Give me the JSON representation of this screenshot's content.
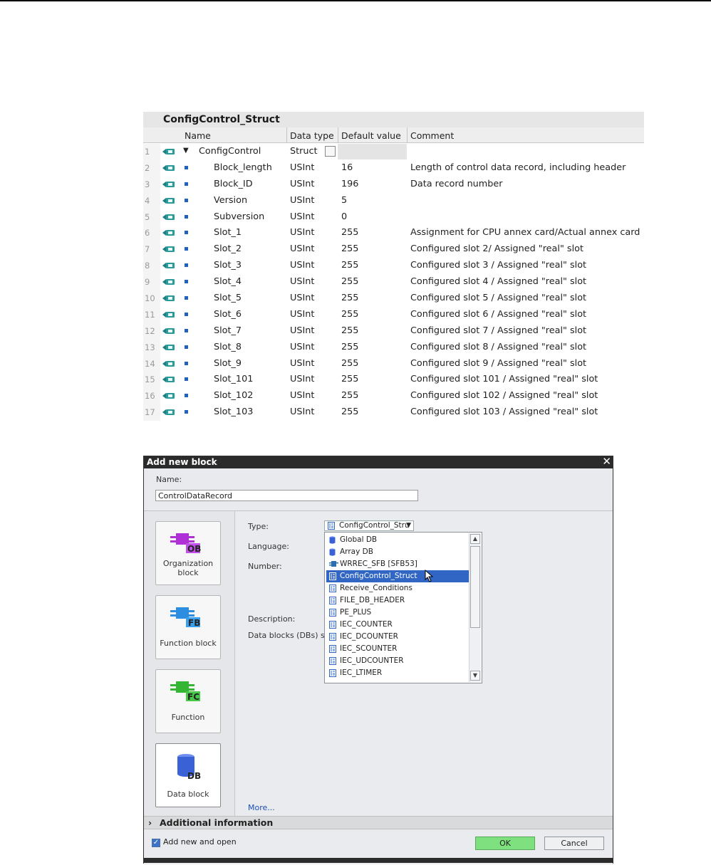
{
  "struct_table": {
    "title": "ConfigControl_Struct",
    "columns": [
      "Name",
      "Data type",
      "Default value",
      "Comment"
    ],
    "rows": [
      {
        "num": "1",
        "name": "ConfigControl",
        "type": "Struct",
        "default": "",
        "comment": ""
      },
      {
        "num": "2",
        "name": "Block_length",
        "type": "USInt",
        "default": "16",
        "comment": "Length of control data record, including header"
      },
      {
        "num": "3",
        "name": "Block_ID",
        "type": "USInt",
        "default": "196",
        "comment": "Data record number"
      },
      {
        "num": "4",
        "name": "Version",
        "type": "USInt",
        "default": "5",
        "comment": ""
      },
      {
        "num": "5",
        "name": "Subversion",
        "type": "USInt",
        "default": "0",
        "comment": ""
      },
      {
        "num": "6",
        "name": "Slot_1",
        "type": "USInt",
        "default": "255",
        "comment": "Assignment for CPU annex card/Actual annex card"
      },
      {
        "num": "7",
        "name": "Slot_2",
        "type": "USInt",
        "default": "255",
        "comment": "Configured slot 2/ Assigned \"real\" slot"
      },
      {
        "num": "8",
        "name": "Slot_3",
        "type": "USInt",
        "default": "255",
        "comment": "Configured slot 3 / Assigned \"real\" slot"
      },
      {
        "num": "9",
        "name": "Slot_4",
        "type": "USInt",
        "default": "255",
        "comment": "Configured slot 4 / Assigned \"real\" slot"
      },
      {
        "num": "10",
        "name": "Slot_5",
        "type": "USInt",
        "default": "255",
        "comment": "Configured slot 5 / Assigned \"real\" slot"
      },
      {
        "num": "11",
        "name": "Slot_6",
        "type": "USInt",
        "default": "255",
        "comment": "Configured slot 6 / Assigned \"real\" slot"
      },
      {
        "num": "12",
        "name": "Slot_7",
        "type": "USInt",
        "default": "255",
        "comment": "Configured slot 7 / Assigned \"real\" slot"
      },
      {
        "num": "13",
        "name": "Slot_8",
        "type": "USInt",
        "default": "255",
        "comment": "Configured slot 8 / Assigned \"real\" slot"
      },
      {
        "num": "14",
        "name": "Slot_9",
        "type": "USInt",
        "default": "255",
        "comment": "Configured slot 9 / Assigned \"real\" slot"
      },
      {
        "num": "15",
        "name": "Slot_101",
        "type": "USInt",
        "default": "255",
        "comment": "Configured slot 101 / Assigned \"real\" slot"
      },
      {
        "num": "16",
        "name": "Slot_102",
        "type": "USInt",
        "default": "255",
        "comment": "Configured slot 102 / Assigned \"real\" slot"
      },
      {
        "num": "17",
        "name": "Slot_103",
        "type": "USInt",
        "default": "255",
        "comment": "Configured slot 103 / Assigned \"real\" slot"
      }
    ]
  },
  "dialog": {
    "title": "Add new block",
    "close_glyph": "✕",
    "name_label": "Name:",
    "name_value": "ControlDataRecord",
    "blocks": [
      {
        "label": "Organization block",
        "badge": "OB",
        "icon": "ob-icon",
        "color": "#b030d8"
      },
      {
        "label": "Function block",
        "badge": "FB",
        "icon": "fb-icon",
        "color": "#2d8de0"
      },
      {
        "label": "Function",
        "badge": "FC",
        "icon": "fc-icon",
        "color": "#34b534"
      },
      {
        "label": "Data block",
        "badge": "DB",
        "icon": "db-icon",
        "color": "#3a62d6"
      }
    ],
    "type_label": "Type:",
    "language_label": "Language:",
    "number_label": "Number:",
    "description_label": "Description:",
    "data_blocks_label": "Data blocks (DBs) sa",
    "type_selected": "ConfigControl_Stru",
    "dropdown_items": [
      {
        "label": "Global DB",
        "icon": "db-cylinder-icon"
      },
      {
        "label": "Array DB",
        "icon": "db-cylinder-icon"
      },
      {
        "label": "WRREC_SFB  [SFB53]",
        "icon": "sfb-icon"
      },
      {
        "label": "ConfigControl_Struct",
        "icon": "struct-icon",
        "selected": true
      },
      {
        "label": "Receive_Conditions",
        "icon": "struct-icon"
      },
      {
        "label": "FILE_DB_HEADER",
        "icon": "struct-icon"
      },
      {
        "label": "PE_PLUS",
        "icon": "struct-icon"
      },
      {
        "label": "IEC_COUNTER",
        "icon": "struct-icon"
      },
      {
        "label": "IEC_DCOUNTER",
        "icon": "struct-icon"
      },
      {
        "label": "IEC_SCOUNTER",
        "icon": "struct-icon"
      },
      {
        "label": "IEC_UDCOUNTER",
        "icon": "struct-icon"
      },
      {
        "label": "IEC_LTIMER",
        "icon": "struct-icon"
      }
    ],
    "more_link": "More...",
    "additional_info": "Additional  information",
    "add_and_open": "Add new and open",
    "ok": "OK",
    "cancel": "Cancel"
  }
}
